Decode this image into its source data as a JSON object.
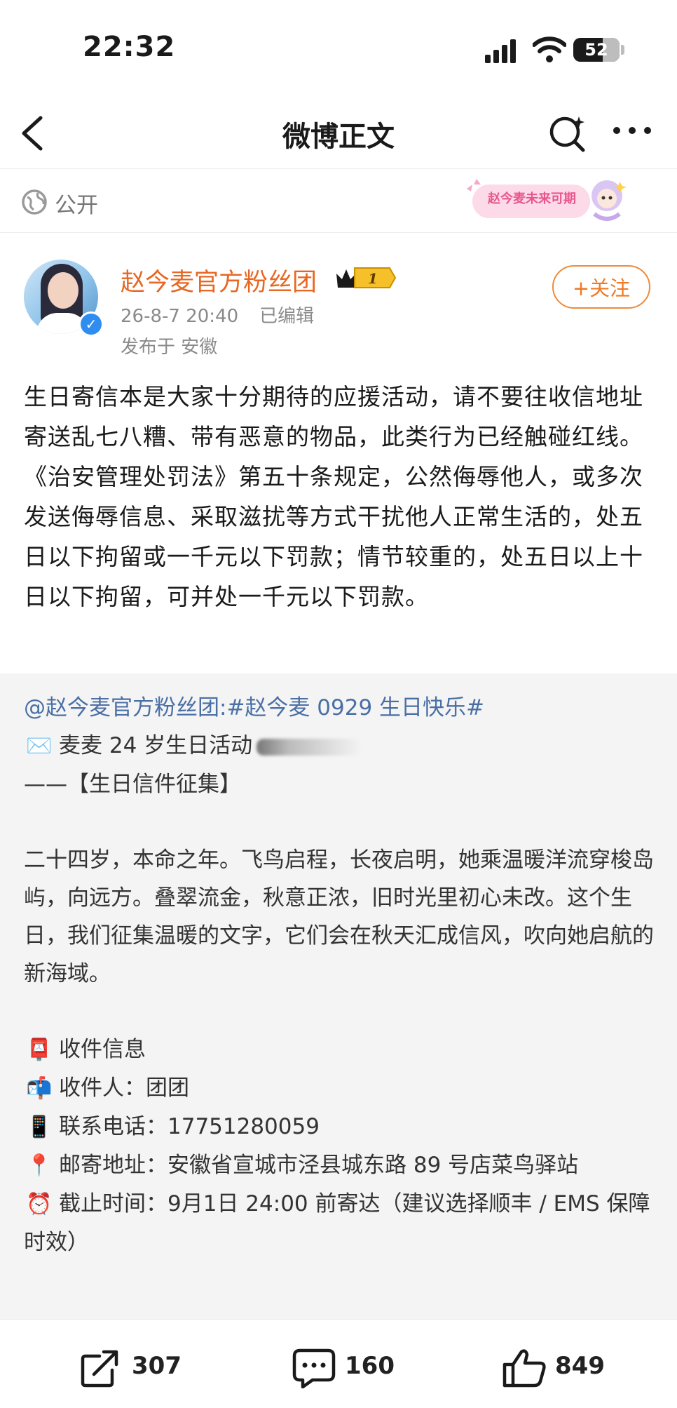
{
  "status_bar": {
    "time": "22:32",
    "battery": "52"
  },
  "nav": {
    "title": "微博正文"
  },
  "visibility": {
    "label": "公开",
    "sticker_text": "赵今麦未来可期"
  },
  "post": {
    "username": "赵今麦官方粉丝团",
    "badge_level": "1",
    "date": "26-8-7 20:40",
    "edited": "已编辑",
    "location": "发布于 安徽",
    "follow_label": "+关注",
    "body": "生日寄信本是大家十分期待的应援活动，请不要往收信地址寄送乱七八糟、带有恶意的物品，此类行为已经触碰红线。《治安管理处罚法》第五十条规定，公然侮辱他人，或多次发送侮辱信息、采取滋扰等方式干扰他人正常生活的，处五日以下拘留或一千元以下罚款；情节较重的，处五日以上十日以下拘留，可并处一千元以下罚款。"
  },
  "repost": {
    "head": "@赵今麦官方粉丝团:#赵今麦 0929 生日快乐#",
    "line1": "麦麦 24 岁生日活动",
    "line2": "——【生日信件征集】",
    "paragraph": "二十四岁，本命之年。飞鸟启程，长夜启明，她乘温暖洋流穿梭岛屿，向远方。叠翠流金，秋意正浓，旧时光里初心未改。这个生日，我们征集温暖的文字，它们会在秋天汇成信风，吹向她启航的新海域。",
    "info_title": "收件信息",
    "recipient": "收件人：团团",
    "phone": "联系电话：17751280059",
    "address": "邮寄地址：安徽省宣城市泾县城东路 89 号店菜鸟驿站",
    "deadline": "截止时间：9月1日 24:00 前寄达（建议选择顺丰 / EMS 保障时效）",
    "emoji": {
      "envelope": "✉️",
      "postbox": "📮",
      "mailbox": "📬",
      "phone": "📱",
      "pin": "📍",
      "clock": "⏰"
    }
  },
  "actions": {
    "repost_count": "307",
    "comment_count": "160",
    "like_count": "849"
  },
  "colors": {
    "username": "#e86722",
    "link": "#4a6fa5",
    "follow": "#ee7a25",
    "repost_bg": "#f4f4f4"
  }
}
